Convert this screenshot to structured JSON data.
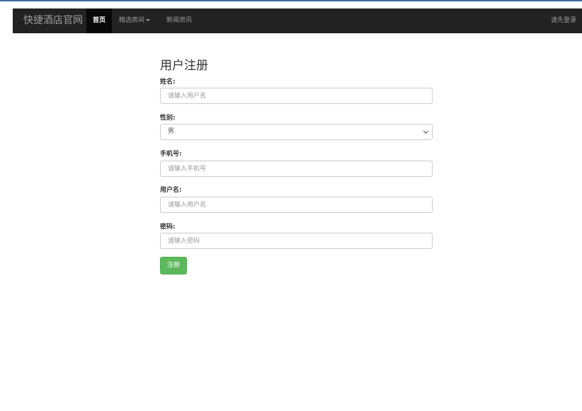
{
  "nav": {
    "brand": "快捷酒店官网",
    "items": [
      {
        "label": "首页"
      },
      {
        "label": "精选房间"
      },
      {
        "label": "新闻资讯"
      }
    ],
    "login": "请先登录"
  },
  "form": {
    "title": "用户注册",
    "fields": {
      "name": {
        "label": "姓名:",
        "placeholder": "请输入用户名"
      },
      "gender": {
        "label": "性别:",
        "value": "男"
      },
      "phone": {
        "label": "手机号:",
        "placeholder": "请输入手机号"
      },
      "username": {
        "label": "用户名:",
        "placeholder": "请输入用户名"
      },
      "password": {
        "label": "密码:",
        "placeholder": "请输入密码"
      }
    },
    "submit": "注册"
  }
}
